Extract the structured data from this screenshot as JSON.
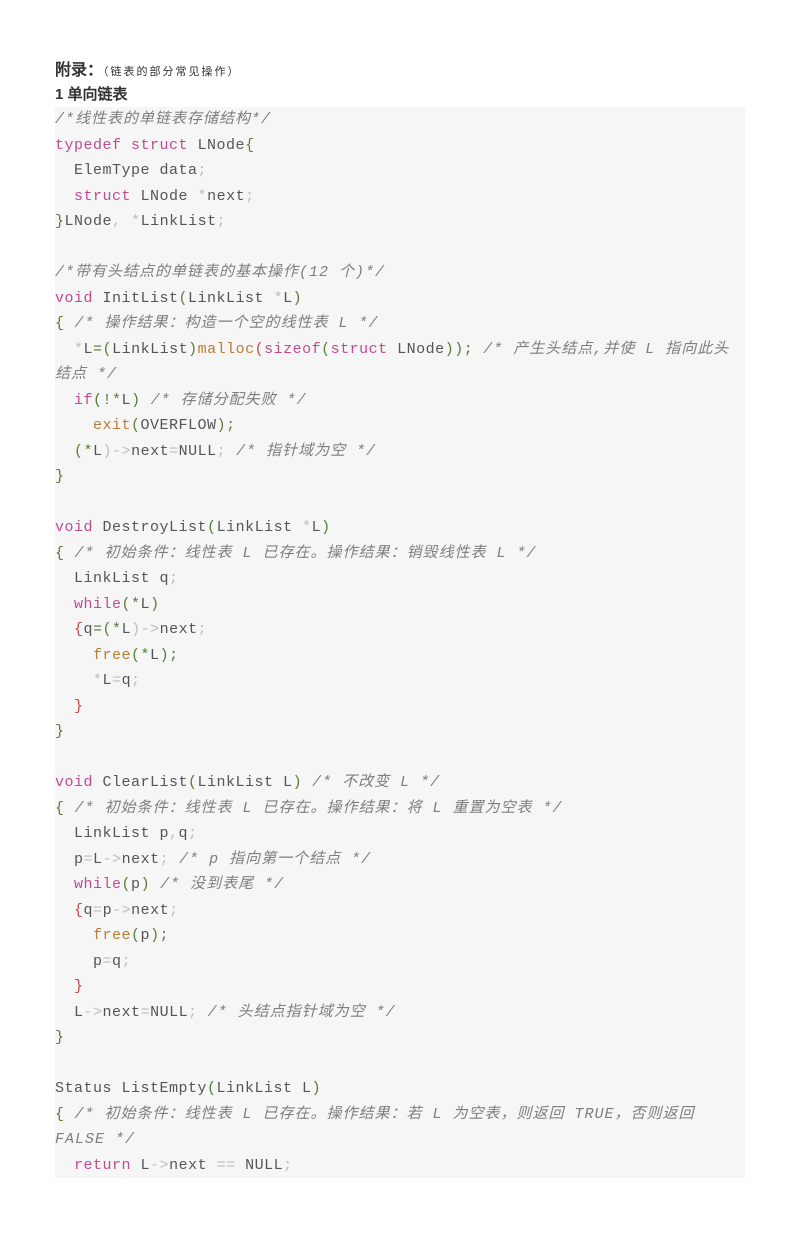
{
  "heading": {
    "appendix": "附录：",
    "subtitle": "（链表的部分常见操作）",
    "section": "1 单向链表"
  },
  "code": {
    "c1": "/*线性表的单链表存储结构*/",
    "l1a": "typedef",
    "l1b": "struct",
    "l1c": " LNode",
    "l1d": "{",
    "l2a": "  ElemType data",
    "l2b": ";",
    "l3a": "  ",
    "l3b": "struct",
    "l3c": " LNode ",
    "l3d": "*",
    "l3e": "next",
    "l3f": ";",
    "l4a": "}",
    "l4b": "LNode",
    "l4c": ",",
    "l4d": " *",
    "l4e": "LinkList",
    "l4f": ";",
    "c2": "/*带有头结点的单链表的基本操作(12 个)*/",
    "l5a": "void",
    "l5b": " InitList",
    "l5c": "(",
    "l5d": "LinkList ",
    "l5e": "*",
    "l5f": "L",
    "l5g": ")",
    "l6a": "{",
    "c3": " /* 操作结果：构造一个空的线性表 L */",
    "l7a": "  ",
    "l7b": "*",
    "l7c": "L",
    "l7d": "=(",
    "l7e": "LinkList",
    "l7f": ")",
    "l7g": "malloc",
    "l7h": "(",
    "l7i": "sizeof",
    "l7j": "(",
    "l7k": "struct",
    "l7l": " LNode",
    "l7m": "));",
    "c4": " /* 产生头结点,并使 L 指向此头结点 */",
    "l8a": "  ",
    "l8b": "if",
    "l8c": "(!*",
    "l8d": "L",
    "l8e": ")",
    "c5": " /* 存储分配失败 */",
    "l9a": "    exit",
    "l9b": "(",
    "l9c": "OVERFLOW",
    "l9d": ");",
    "l10a": "  ",
    "l10b": "(*",
    "l10c": "L",
    "l10d": ")->",
    "l10e": "next",
    "l10f": "=",
    "l10g": "NULL",
    "l10h": ";",
    "c6": " /* 指针域为空 */",
    "l11a": "}",
    "l12a": "void",
    "l12b": " DestroyList",
    "l12c": "(",
    "l12d": "LinkList ",
    "l12e": "*",
    "l12f": "L",
    "l12g": ")",
    "l13a": "{",
    "c7": " /* 初始条件：线性表 L 已存在。操作结果：销毁线性表 L */",
    "l14a": "  LinkList q",
    "l14b": ";",
    "l15a": "  ",
    "l15b": "while",
    "l15c": "(*",
    "l15d": "L",
    "l15e": ")",
    "l16a": "  {",
    "l16b": "q",
    "l16c": "=(*",
    "l16d": "L",
    "l16e": ")->",
    "l16f": "next",
    "l16g": ";",
    "l17a": "    free",
    "l17b": "(*",
    "l17c": "L",
    "l17d": ");",
    "l18a": "    ",
    "l18b": "*",
    "l18c": "L",
    "l18d": "=",
    "l18e": "q",
    "l18f": ";",
    "l19a": "  }",
    "l20a": "}",
    "l21a": "void",
    "l21b": " ClearList",
    "l21c": "(",
    "l21d": "LinkList L",
    "l21e": ")",
    "c8": " /* 不改变 L */",
    "l22a": "{",
    "c9": " /* 初始条件：线性表 L 已存在。操作结果：将 L 重置为空表 */",
    "l23a": "  LinkList p",
    "l23b": ",",
    "l23c": "q",
    "l23d": ";",
    "l24a": "  p",
    "l24b": "=",
    "l24c": "L",
    "l24d": "->",
    "l24e": "next",
    "l24f": ";",
    "c10": " /* p 指向第一个结点 */",
    "l25a": "  ",
    "l25b": "while",
    "l25c": "(",
    "l25d": "p",
    "l25e": ")",
    "c11": " /* 没到表尾 */",
    "l26a": "  {",
    "l26b": "q",
    "l26c": "=",
    "l26d": "p",
    "l26e": "->",
    "l26f": "next",
    "l26g": ";",
    "l27a": "    free",
    "l27b": "(",
    "l27c": "p",
    "l27d": ");",
    "l28a": "    p",
    "l28b": "=",
    "l28c": "q",
    "l28d": ";",
    "l29a": "  }",
    "l30a": "  L",
    "l30b": "->",
    "l30c": "next",
    "l30d": "=",
    "l30e": "NULL",
    "l30f": ";",
    "c12": " /* 头结点指针域为空 */",
    "l31a": "}",
    "l32a": "Status ListEmpty",
    "l32b": "(",
    "l32c": "LinkList L",
    "l32d": ")",
    "l33a": "{",
    "c13": " /* 初始条件：线性表 L 已存在。操作结果：若 L 为空表，则返回 TRUE，否则返回 FALSE */",
    "l34a": "  ",
    "l34b": "return",
    "l34c": " L",
    "l34d": "->",
    "l34e": "next ",
    "l34f": "==",
    "l34g": " NULL",
    "l34h": ";"
  }
}
